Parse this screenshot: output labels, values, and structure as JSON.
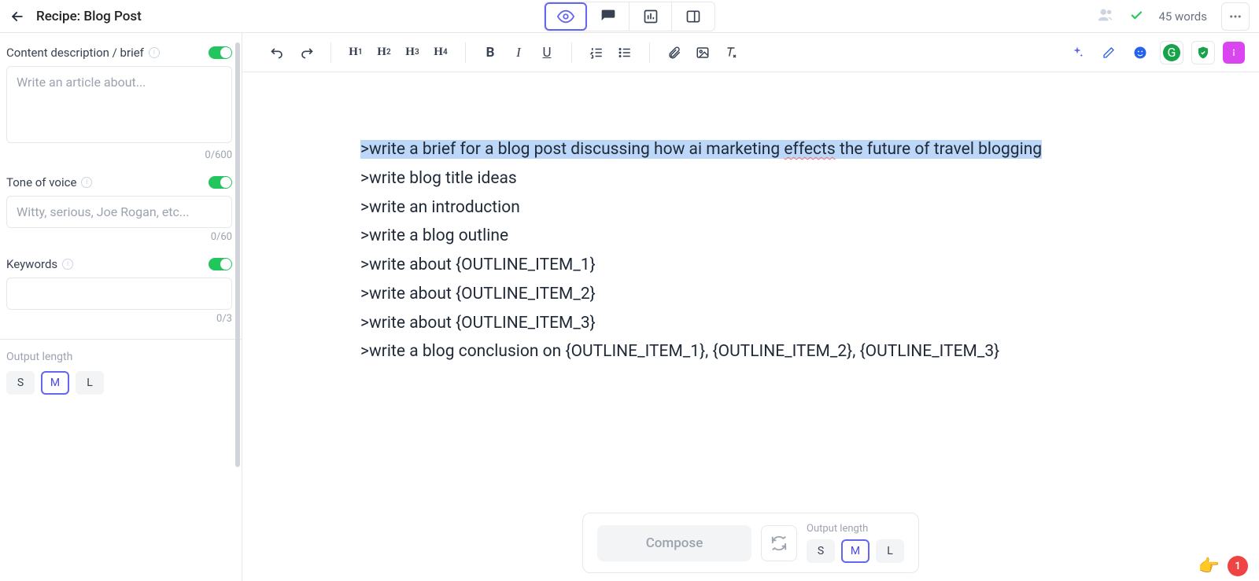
{
  "header": {
    "title": "Recipe: Blog Post",
    "word_count": "45 words"
  },
  "sidebar": {
    "fields": {
      "brief": {
        "label": "Content description / brief",
        "placeholder": "Write an article about...",
        "counter": "0/600"
      },
      "tone": {
        "label": "Tone of voice",
        "placeholder": "Witty, serious, Joe Rogan, etc...",
        "counter": "0/60"
      },
      "keywords": {
        "label": "Keywords",
        "counter": "0/3"
      }
    },
    "output_length_label": "Output length",
    "length_options": {
      "s": "S",
      "m": "M",
      "l": "L"
    }
  },
  "document": {
    "lines": [
      ">write a brief for a blog post discussing how ai marketing effects the future of travel blogging",
      ">write blog title ideas",
      ">write an introduction",
      ">write a blog outline",
      ">write about {OUTLINE_ITEM_1}",
      ">write about {OUTLINE_ITEM_2}",
      ">write about {OUTLINE_ITEM_3}",
      ">write a blog conclusion on {OUTLINE_ITEM_1}, {OUTLINE_ITEM_2}, {OUTLINE_ITEM_3}"
    ],
    "squiggle_word": "effects"
  },
  "compose": {
    "button": "Compose",
    "output_length_label": "Output length",
    "length_options": {
      "s": "S",
      "m": "M",
      "l": "L"
    }
  },
  "notifications": {
    "count": "1"
  }
}
